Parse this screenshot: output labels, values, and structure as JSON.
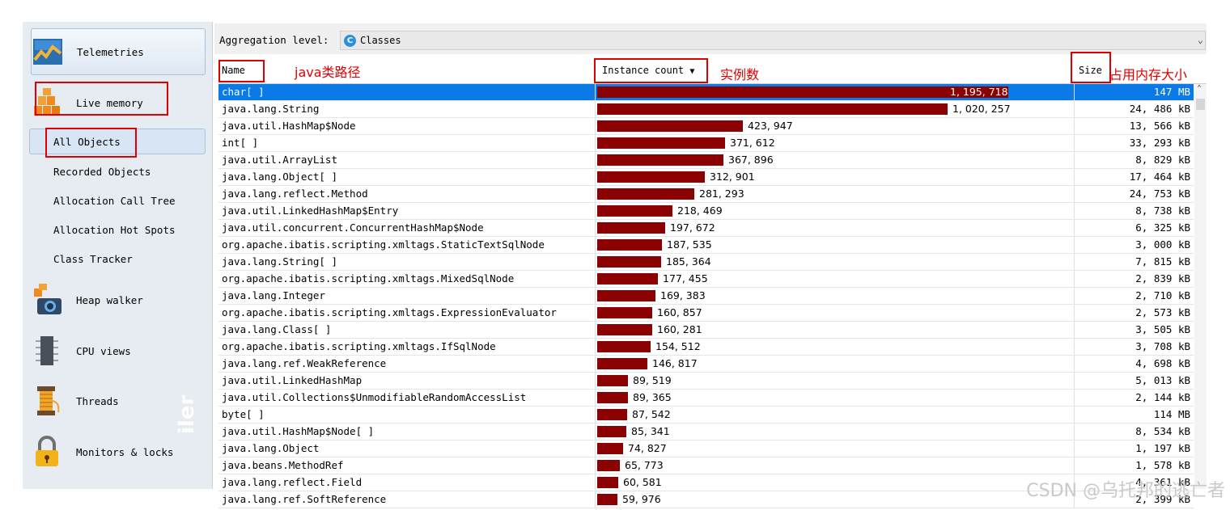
{
  "sidebar": {
    "telemetries": "Telemetries",
    "live_memory": "Live memory",
    "sub_items": [
      "All Objects",
      "Recorded Objects",
      "Allocation Call Tree",
      "Allocation Hot Spots",
      "Class Tracker"
    ],
    "heap_walker": "Heap walker",
    "cpu_views": "CPU views",
    "threads": "Threads",
    "monitors": "Monitors & locks",
    "side_text": "iler"
  },
  "aggregation": {
    "label": "Aggregation level:",
    "value": "Classes",
    "icon_letter": "C"
  },
  "columns": {
    "name": "Name",
    "instance_count": "Instance count",
    "size": "Size"
  },
  "annotations": {
    "name_note": "java类路径",
    "count_note": "实例数",
    "size_note": "占用内存大小"
  },
  "rows": [
    {
      "name": "char[ ]",
      "count": "1, 195, 718",
      "value": 1195718,
      "size": "147 MB"
    },
    {
      "name": "java.lang.String",
      "count": "1, 020, 257",
      "value": 1020257,
      "size": "24, 486 kB"
    },
    {
      "name": "java.util.HashMap$Node",
      "count": "423, 947",
      "value": 423947,
      "size": "13, 566 kB"
    },
    {
      "name": "int[ ]",
      "count": "371, 612",
      "value": 371612,
      "size": "33, 293 kB"
    },
    {
      "name": "java.util.ArrayList",
      "count": "367, 896",
      "value": 367896,
      "size": "8, 829 kB"
    },
    {
      "name": "java.lang.Object[ ]",
      "count": "312, 901",
      "value": 312901,
      "size": "17, 464 kB"
    },
    {
      "name": "java.lang.reflect.Method",
      "count": "281, 293",
      "value": 281293,
      "size": "24, 753 kB"
    },
    {
      "name": "java.util.LinkedHashMap$Entry",
      "count": "218, 469",
      "value": 218469,
      "size": "8, 738 kB"
    },
    {
      "name": "java.util.concurrent.ConcurrentHashMap$Node",
      "count": "197, 672",
      "value": 197672,
      "size": "6, 325 kB"
    },
    {
      "name": "org.apache.ibatis.scripting.xmltags.StaticTextSqlNode",
      "count": "187, 535",
      "value": 187535,
      "size": "3, 000 kB"
    },
    {
      "name": "java.lang.String[ ]",
      "count": "185, 364",
      "value": 185364,
      "size": "7, 815 kB"
    },
    {
      "name": "org.apache.ibatis.scripting.xmltags.MixedSqlNode",
      "count": "177, 455",
      "value": 177455,
      "size": "2, 839 kB"
    },
    {
      "name": "java.lang.Integer",
      "count": "169, 383",
      "value": 169383,
      "size": "2, 710 kB"
    },
    {
      "name": "org.apache.ibatis.scripting.xmltags.ExpressionEvaluator",
      "count": "160, 857",
      "value": 160857,
      "size": "2, 573 kB"
    },
    {
      "name": "java.lang.Class[ ]",
      "count": "160, 281",
      "value": 160281,
      "size": "3, 505 kB"
    },
    {
      "name": "org.apache.ibatis.scripting.xmltags.IfSqlNode",
      "count": "154, 512",
      "value": 154512,
      "size": "3, 708 kB"
    },
    {
      "name": "java.lang.ref.WeakReference",
      "count": "146, 817",
      "value": 146817,
      "size": "4, 698 kB"
    },
    {
      "name": "java.util.LinkedHashMap",
      "count": "89, 519",
      "value": 89519,
      "size": "5, 013 kB"
    },
    {
      "name": "java.util.Collections$UnmodifiableRandomAccessList",
      "count": "89, 365",
      "value": 89365,
      "size": "2, 144 kB"
    },
    {
      "name": "byte[ ]",
      "count": "87, 542",
      "value": 87542,
      "size": "114 MB"
    },
    {
      "name": "java.util.HashMap$Node[ ]",
      "count": "85, 341",
      "value": 85341,
      "size": "8, 534 kB"
    },
    {
      "name": "java.lang.Object",
      "count": "74, 827",
      "value": 74827,
      "size": "1, 197 kB"
    },
    {
      "name": "java.beans.MethodRef",
      "count": "65, 773",
      "value": 65773,
      "size": "1, 578 kB"
    },
    {
      "name": "java.lang.reflect.Field",
      "count": "60, 581",
      "value": 60581,
      "size": "4, 361 kB"
    },
    {
      "name": "java.lang.ref.SoftReference",
      "count": "59, 976",
      "value": 59976,
      "size": "2, 399 kB"
    }
  ],
  "colors": {
    "bar": "#8b0000",
    "selected": "#0a7be6",
    "annotation": "#e00000"
  },
  "watermark": "CSDN @乌托邦的逃亡者"
}
